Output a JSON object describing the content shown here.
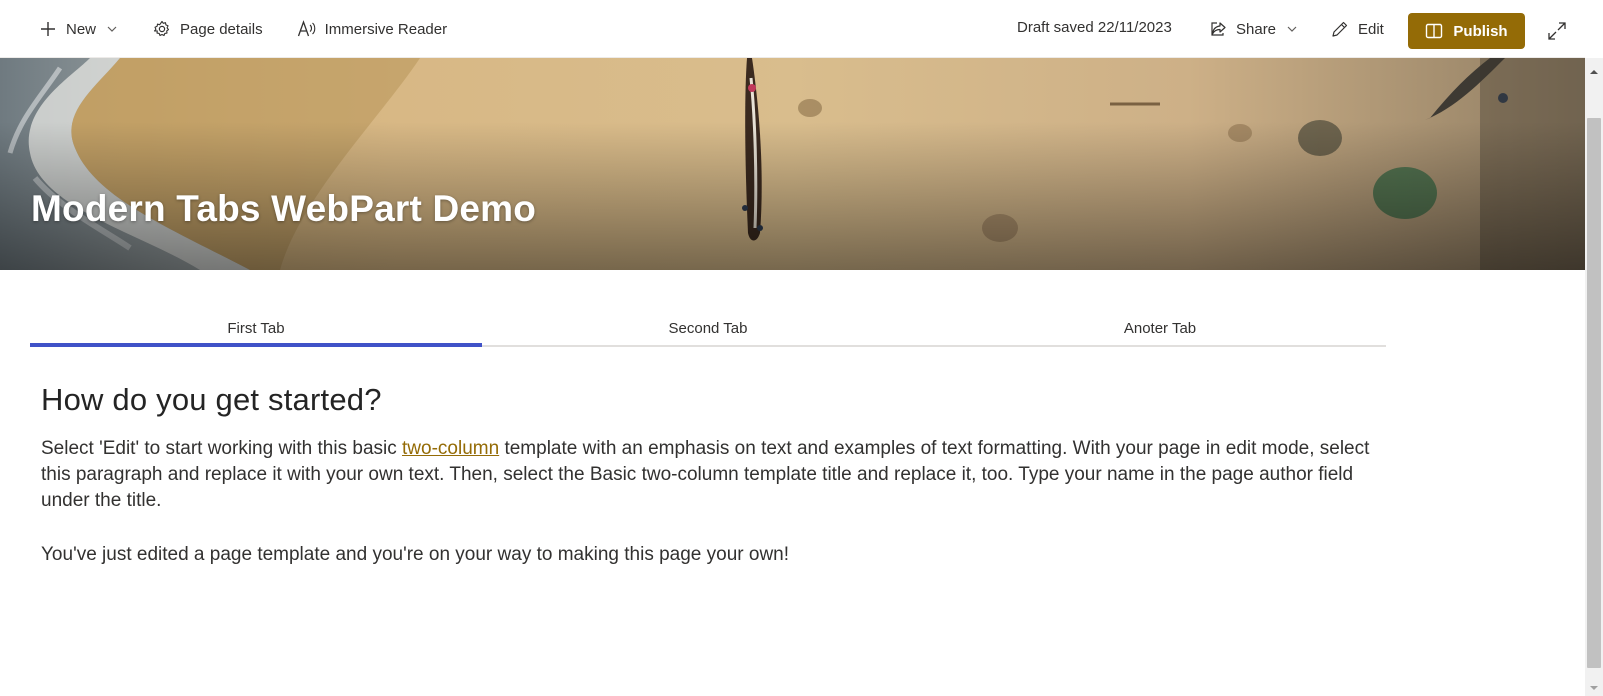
{
  "command_bar": {
    "new_label": "New",
    "page_details_label": "Page details",
    "immersive_reader_label": "Immersive Reader",
    "status_text": "Draft saved 22/11/2023",
    "share_label": "Share",
    "edit_label": "Edit",
    "publish_label": "Publish",
    "accent_color": "#946b06"
  },
  "hero": {
    "title": "Modern Tabs WebPart Demo"
  },
  "tabs": [
    {
      "label": "First Tab",
      "active": true
    },
    {
      "label": "Second Tab",
      "active": false
    },
    {
      "label": "Anoter Tab",
      "active": false
    }
  ],
  "tab_accent_color": "#4052c8",
  "content": {
    "heading": "How do you get started?",
    "paragraph1_before_link": "Select 'Edit' to start working with this basic ",
    "paragraph1_link": "two-column",
    "paragraph1_after_link": " template with an emphasis on text and examples of text formatting. With your page in edit mode, select this paragraph and replace it with your own text. Then, select the Basic two-column template title and replace it, too. Type your name in the page author field under the title.",
    "paragraph2": "You've just edited a page template and you're on your way to making this page your own!"
  },
  "icons": {
    "new": "plus-icon",
    "page_details": "gear-icon",
    "immersive_reader": "immersive-reader-icon",
    "share": "share-icon",
    "edit": "pencil-icon",
    "publish": "book-icon",
    "expand": "expand-icon"
  }
}
